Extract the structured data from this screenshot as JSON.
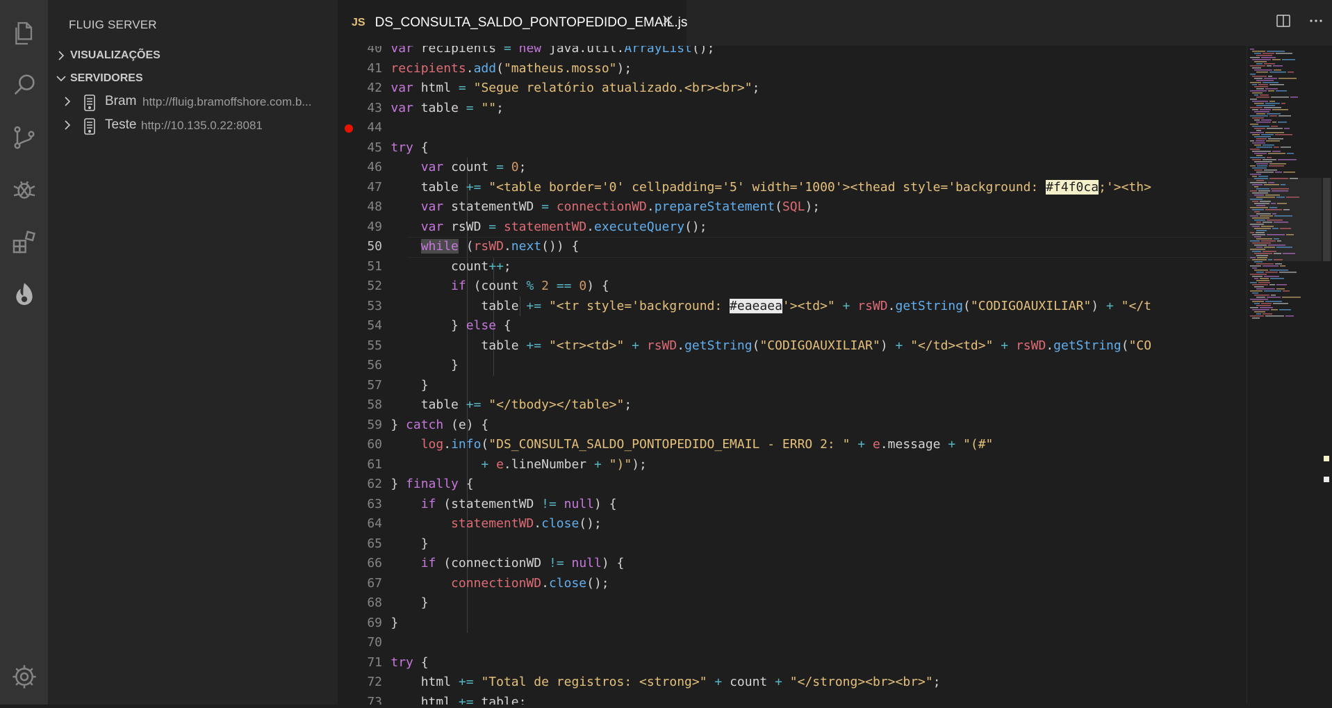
{
  "sidebar": {
    "title": "FLUIG SERVER",
    "sections": [
      {
        "label": "VISUALIZAÇÕES",
        "expanded": false
      },
      {
        "label": "SERVIDORES",
        "expanded": true
      }
    ],
    "servers": [
      {
        "name": "Bram",
        "url": "http://fluig.bramoffshore.com.b..."
      },
      {
        "name": "Teste",
        "url": "http://10.135.0.22:8081"
      }
    ]
  },
  "tab": {
    "badge": "JS",
    "filename": "DS_CONSULTA_SALDO_PONTOPEDIDO_EMAIL.js"
  },
  "activity_icons": [
    "explorer-icon",
    "search-icon",
    "source-control-icon",
    "debug-icon",
    "extensions-icon",
    "fluig-icon",
    "gear-icon"
  ],
  "editor": {
    "current_line": 50,
    "breakpoint_line": 44,
    "lines": [
      {
        "n": "40",
        "text": "    var recipients = new java.util.ArrayList();"
      },
      {
        "n": "41",
        "text": "    recipients.add(\"matheus.mosso\");"
      },
      {
        "n": "42",
        "text": "    var html = \"Segue relatório atualizado.<br><br>\";"
      },
      {
        "n": "43",
        "text": "    var table = \"\";"
      },
      {
        "n": "44",
        "text": ""
      },
      {
        "n": "45",
        "text": "    try {"
      },
      {
        "n": "46",
        "text": "        var count = 0;"
      },
      {
        "n": "47",
        "text": "        table += \"<table border='0' cellpadding='5' width='1000'><thead style='background: #f4f0ca;'><th>"
      },
      {
        "n": "48",
        "text": "        var statementWD = connectionWD.prepareStatement(SQL);"
      },
      {
        "n": "49",
        "text": "        var rsWD = statementWD.executeQuery();"
      },
      {
        "n": "50",
        "text": "        while (rsWD.next()) {"
      },
      {
        "n": "51",
        "text": "            count++;"
      },
      {
        "n": "52",
        "text": "            if (count % 2 == 0) {"
      },
      {
        "n": "53",
        "text": "                table += \"<tr style='background: #eaeaea'><td>\" + rsWD.getString(\"CODIGOAUXILIAR\") + \"</t"
      },
      {
        "n": "54",
        "text": "            } else {"
      },
      {
        "n": "55",
        "text": "                table += \"<tr><td>\" + rsWD.getString(\"CODIGOAUXILIAR\") + \"</td><td>\" + rsWD.getString(\"CO"
      },
      {
        "n": "56",
        "text": "            }"
      },
      {
        "n": "57",
        "text": "        }"
      },
      {
        "n": "58",
        "text": "        table += \"</tbody></table>\";"
      },
      {
        "n": "59",
        "text": "    } catch (e) {"
      },
      {
        "n": "60",
        "text": "        log.info(\"DS_CONSULTA_SALDO_PONTOPEDIDO_EMAIL - ERRO 2: \" + e.message + \"(#\""
      },
      {
        "n": "61",
        "text": "                + e.lineNumber + \")\");"
      },
      {
        "n": "62",
        "text": "    } finally {"
      },
      {
        "n": "63",
        "text": "        if (statementWD != null) {"
      },
      {
        "n": "64",
        "text": "            statementWD.close();"
      },
      {
        "n": "65",
        "text": "        }"
      },
      {
        "n": "66",
        "text": "        if (connectionWD != null) {"
      },
      {
        "n": "67",
        "text": "            connectionWD.close();"
      },
      {
        "n": "68",
        "text": "        }"
      },
      {
        "n": "69",
        "text": "    }"
      },
      {
        "n": "70",
        "text": ""
      },
      {
        "n": "71",
        "text": "    try {"
      },
      {
        "n": "72",
        "text": "        html += \"Total de registros: <strong>\" + count + \"</strong><br><br>\";"
      },
      {
        "n": "73",
        "text": "        html += table;"
      }
    ]
  }
}
